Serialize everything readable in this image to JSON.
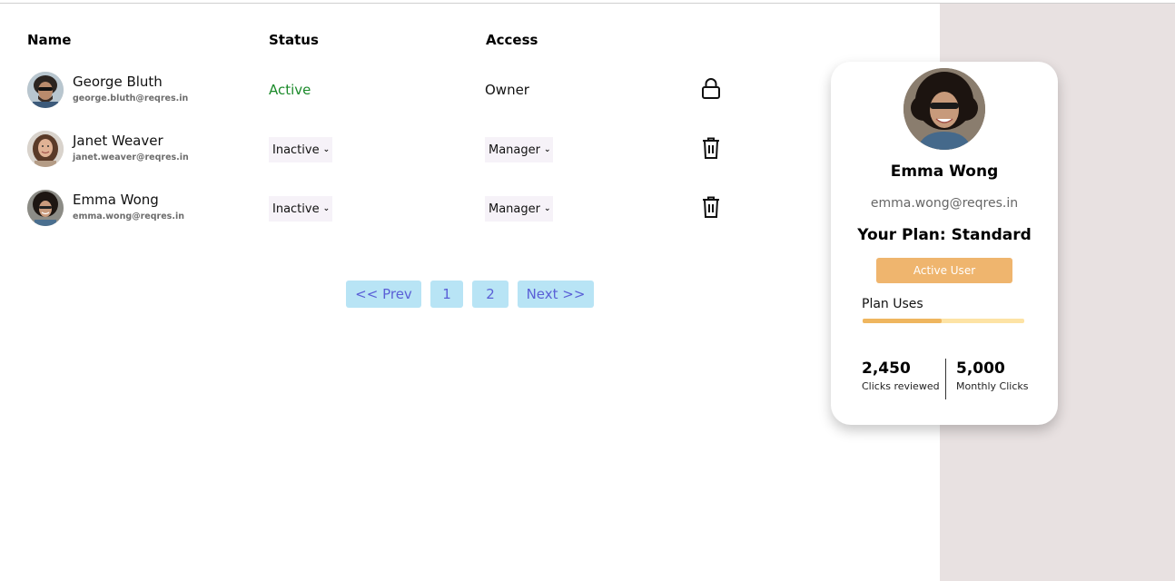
{
  "table": {
    "headers": {
      "name": "Name",
      "status": "Status",
      "access": "Access"
    },
    "rows": [
      {
        "name": "George Bluth",
        "email": "george.bluth@reqres.in",
        "status": "Active",
        "access": "Owner",
        "icon": "lock-icon"
      },
      {
        "name": "Janet Weaver",
        "email": "janet.weaver@reqres.in",
        "status": "Inactive",
        "access": "Manager",
        "icon": "trash-icon"
      },
      {
        "name": "Emma Wong",
        "email": "emma.wong@reqres.in",
        "status": "Inactive",
        "access": "Manager",
        "icon": "trash-icon"
      }
    ]
  },
  "pagination": {
    "prev": "<< Prev",
    "pages": [
      "1",
      "2"
    ],
    "next": "Next >>"
  },
  "card": {
    "name": "Emma Wong",
    "email": "emma.wong@reqres.in",
    "plan": "Your Plan: Standard",
    "status_button": "Active User",
    "uses_label": "Plan Uses",
    "uses_fraction": 0.49,
    "stats": [
      {
        "value": "2,450",
        "label": "Clicks reviewed"
      },
      {
        "value": "5,000",
        "label": "Monthly Clicks"
      }
    ]
  },
  "colors": {
    "active_status": "#1b8a2a",
    "pager_bg": "#b8e4f5",
    "pager_text": "#5a5fd6",
    "accent": "#efb56e",
    "side_panel": "#e8e1e1"
  }
}
